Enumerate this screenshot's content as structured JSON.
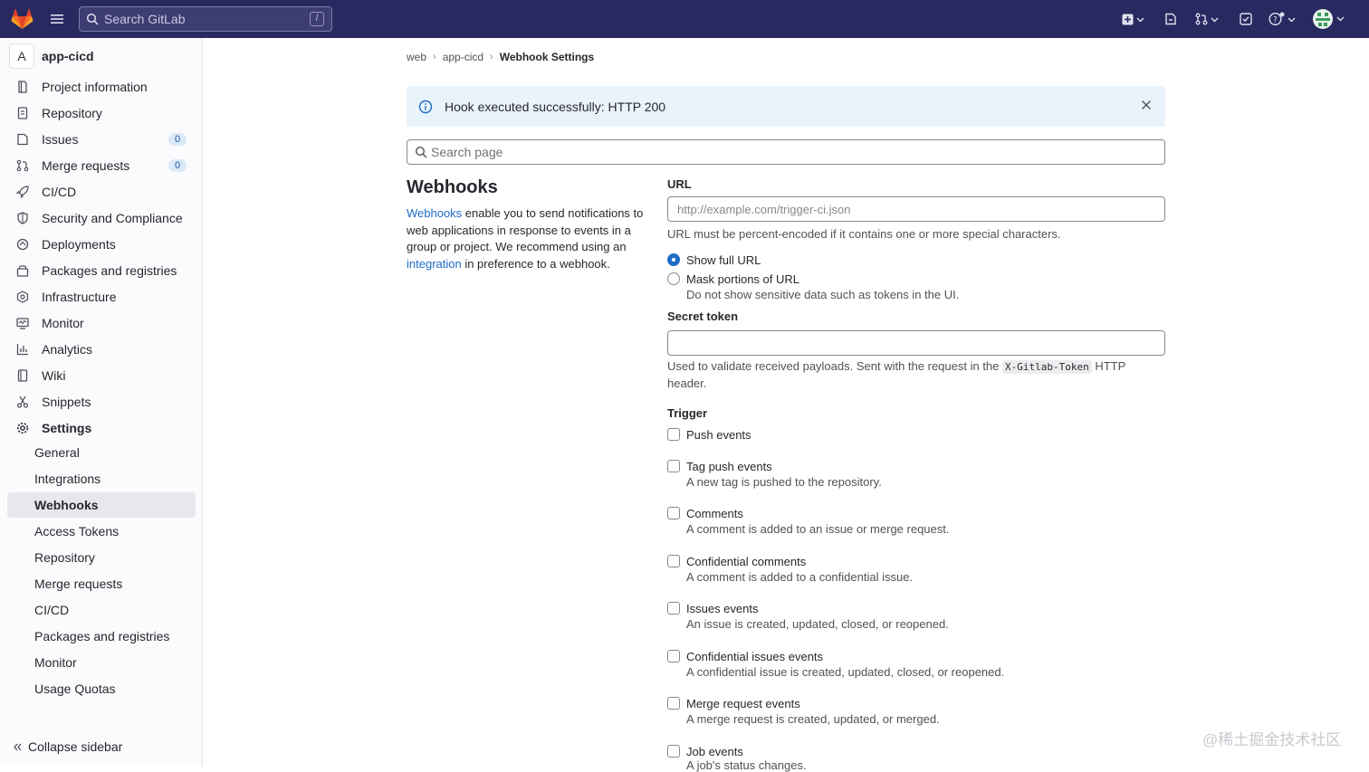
{
  "topbar": {
    "search_placeholder": "Search GitLab",
    "search_shortcut": "/",
    "icons": [
      "plus-square-icon",
      "issues-icon",
      "merge-request-icon",
      "todo-icon",
      "help-icon",
      "avatar"
    ]
  },
  "sidebar": {
    "project_avatar_letter": "A",
    "project_name": "app-cicd",
    "items": [
      {
        "label": "Project information",
        "icon": "project-icon"
      },
      {
        "label": "Repository",
        "icon": "doc-icon"
      },
      {
        "label": "Issues",
        "icon": "issues-icon",
        "count": "0"
      },
      {
        "label": "Merge requests",
        "icon": "merge-request-icon",
        "count": "0"
      },
      {
        "label": "CI/CD",
        "icon": "rocket-icon"
      },
      {
        "label": "Security and Compliance",
        "icon": "shield-icon"
      },
      {
        "label": "Deployments",
        "icon": "deployments-icon"
      },
      {
        "label": "Packages and registries",
        "icon": "package-icon"
      },
      {
        "label": "Infrastructure",
        "icon": "cloud-gear-icon"
      },
      {
        "label": "Monitor",
        "icon": "monitor-icon"
      },
      {
        "label": "Analytics",
        "icon": "chart-icon"
      },
      {
        "label": "Wiki",
        "icon": "book-icon"
      },
      {
        "label": "Snippets",
        "icon": "scissors-icon"
      },
      {
        "label": "Settings",
        "icon": "gear-icon"
      }
    ],
    "settings_sub": [
      {
        "label": "General"
      },
      {
        "label": "Integrations"
      },
      {
        "label": "Webhooks",
        "active": true
      },
      {
        "label": "Access Tokens"
      },
      {
        "label": "Repository"
      },
      {
        "label": "Merge requests"
      },
      {
        "label": "CI/CD"
      },
      {
        "label": "Packages and registries"
      },
      {
        "label": "Monitor"
      },
      {
        "label": "Usage Quotas"
      }
    ],
    "collapse_label": "Collapse sidebar"
  },
  "breadcrumb": [
    "web",
    "app-cicd",
    "Webhook Settings"
  ],
  "alert": {
    "text": "Hook executed successfully: HTTP 200"
  },
  "page_search_placeholder": "Search page",
  "webhooks": {
    "title": "Webhooks",
    "desc_link1": "Webhooks",
    "desc_part1": " enable you to send notifications to web applications in response to events in a group or project. We recommend using an ",
    "desc_link2": "integration",
    "desc_part2": " in preference to a webhook."
  },
  "form": {
    "url_label": "URL",
    "url_placeholder": "http://example.com/trigger-ci.json",
    "url_help": "URL must be percent-encoded if it contains one or more special characters.",
    "radio_show": "Show full URL",
    "radio_mask": "Mask portions of URL",
    "radio_mask_help": "Do not show sensitive data such as tokens in the UI.",
    "secret_label": "Secret token",
    "secret_value": "",
    "secret_help_1": "Used to validate received payloads. Sent with the request in the ",
    "secret_help_code": "X-Gitlab-Token",
    "secret_help_2": " HTTP",
    "secret_help_3": "header.",
    "trigger_label": "Trigger",
    "triggers": [
      {
        "label": "Push events",
        "help": ""
      },
      {
        "label": "Tag push events",
        "help": "A new tag is pushed to the repository."
      },
      {
        "label": "Comments",
        "help": "A comment is added to an issue or merge request."
      },
      {
        "label": "Confidential comments",
        "help": "A comment is added to a confidential issue."
      },
      {
        "label": "Issues events",
        "help": "An issue is created, updated, closed, or reopened."
      },
      {
        "label": "Confidential issues events",
        "help": "A confidential issue is created, updated, closed, or reopened."
      },
      {
        "label": "Merge request events",
        "help": "A merge request is created, updated, or merged."
      },
      {
        "label": "Job events",
        "help": "A job's status changes."
      }
    ]
  },
  "watermark": "@稀土掘金技术社区",
  "colors": {
    "topbar": "#292961",
    "link": "#1f6cc5",
    "alert_bg": "#e9f3fc",
    "active_nav": "#e8e7ec"
  }
}
